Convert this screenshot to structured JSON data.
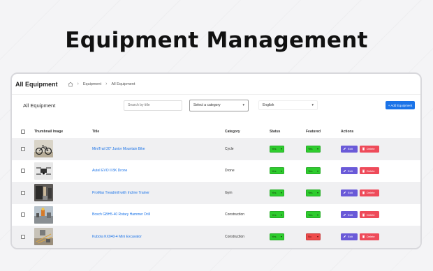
{
  "hero": {
    "title": "Equipment Management"
  },
  "header": {
    "page_title": "All Equipment",
    "breadcrumb": [
      "Equipment",
      "All Equipment"
    ]
  },
  "toolbar": {
    "section_title": "All Equipment",
    "search_placeholder": "Search by title",
    "category_placeholder": "Select a category",
    "language": "English",
    "add_label": "+ Add Equipment"
  },
  "table": {
    "columns": [
      "Thumbnail Image",
      "Title",
      "Category",
      "Status",
      "Featured",
      "Actions"
    ],
    "rows": [
      {
        "title": "MiniTrail 20\" Junior Mountain Bike",
        "category": "Cycle",
        "status": "Yes",
        "featured": "Yes",
        "thumb": "bike"
      },
      {
        "title": "AuteI EVO II 8K Drone",
        "category": "Drone",
        "status": "Yes",
        "featured": "Yes",
        "thumb": "drone"
      },
      {
        "title": "ProMax Treadmill with Incline Trainer",
        "category": "Gym",
        "status": "Yes",
        "featured": "Yes",
        "thumb": "gym"
      },
      {
        "title": "Bosch GBH5-40 Rotary Hammer Drill",
        "category": "Construction",
        "status": "Yes",
        "featured": "Yes",
        "thumb": "construction"
      },
      {
        "title": "Kubota KX040-4 Mini Excavator",
        "category": "Construction",
        "status": "Yes",
        "featured": "No",
        "thumb": "excavator"
      }
    ],
    "edit_label": "Edit",
    "delete_label": "Delete"
  },
  "colors": {
    "accent": "#1a73e8",
    "yes": "#2ecc2e",
    "no": "#ee4b4b",
    "edit": "#6a5ad8",
    "delete": "#ee4b5a"
  }
}
